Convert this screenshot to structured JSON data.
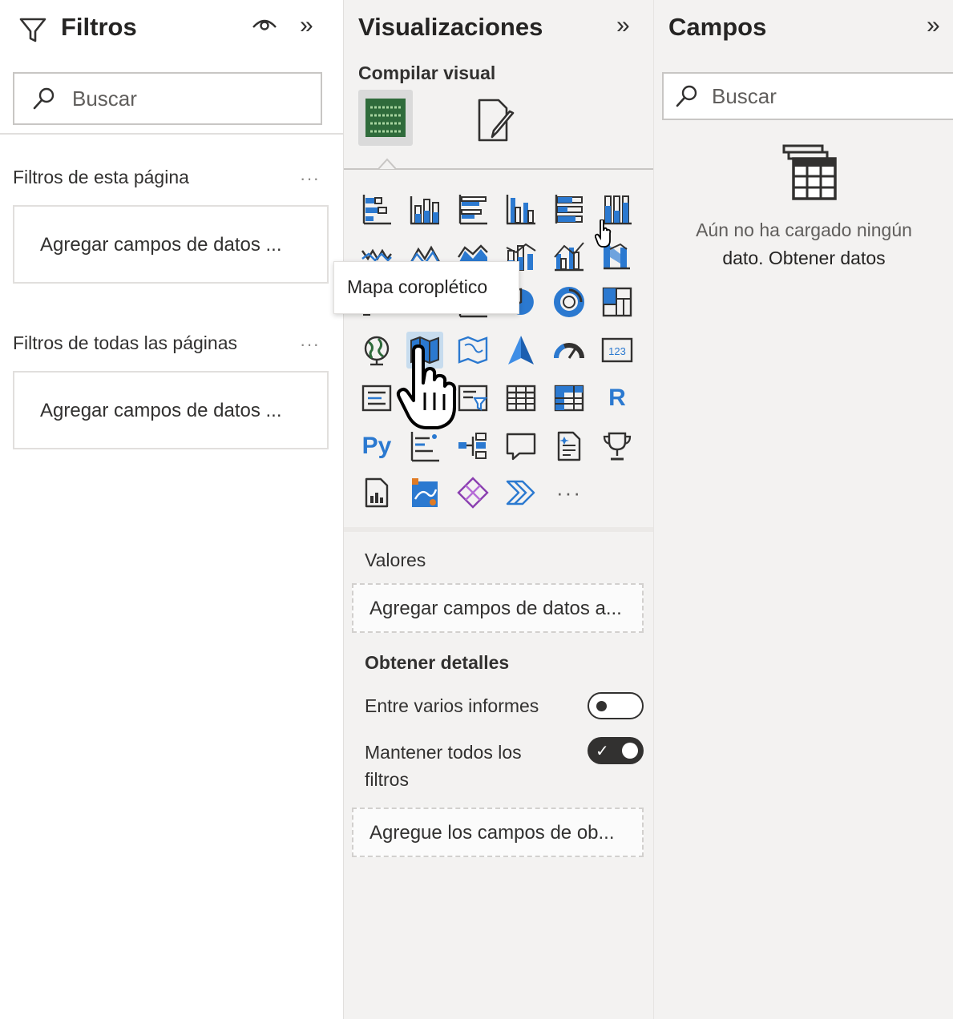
{
  "filters": {
    "title": "Filtros",
    "search_placeholder": "Buscar",
    "page_section": "Filtros de esta página",
    "page_dropzone": "Agregar campos de datos ...",
    "all_section": "Filtros de todas las páginas",
    "all_dropzone": "Agregar campos de datos ...",
    "more_label": "···",
    "collapse_label": "»"
  },
  "visualizations": {
    "title": "Visualizaciones",
    "collapse_label": "»",
    "build_label": "Compilar visual",
    "tooltip": "Mapa coroplético",
    "icons": [
      [
        "stacked-bar-chart-icon",
        "stacked-column-chart-icon",
        "clustered-bar-chart-icon",
        "clustered-column-chart-icon",
        "100-stacked-bar-chart-icon",
        "100-stacked-column-chart-icon"
      ],
      [
        "line-chart-icon",
        "area-chart-icon",
        "stacked-area-chart-icon",
        "line-stacked-column-icon",
        "line-clustered-column-icon",
        "ribbon-chart-icon"
      ],
      [
        "waterfall-chart-icon",
        "funnel-chart-icon",
        "scatter-chart-icon",
        "pie-chart-icon",
        "donut-chart-icon",
        "treemap-icon"
      ],
      [
        "map-icon",
        "filled-map-icon",
        "shape-map-icon",
        "azure-map-icon",
        "gauge-icon",
        "card-icon"
      ],
      [
        "multi-row-card-icon",
        "kpi-icon",
        "slicer-icon",
        "table-icon",
        "matrix-icon",
        "r-visual-icon"
      ],
      [
        "python-visual-icon",
        "key-influencers-icon",
        "decomposition-tree-icon",
        "qa-icon",
        "smart-narrative-icon",
        "metrics-icon"
      ],
      [
        "paginated-report-icon",
        "arcgis-map-icon",
        "power-apps-icon",
        "power-automate-icon",
        "more-visuals-icon"
      ]
    ],
    "r_label": "R",
    "py_label": "Py",
    "card_label": "123",
    "more_label": "···",
    "values_title": "Valores",
    "values_dropzone": "Agregar campos de datos a...",
    "drill_title": "Obtener detalles",
    "cross_report_label": "Entre varios informes",
    "cross_report_on": false,
    "keep_filters_label": "Mantener todos los filtros",
    "keep_filters_on": true,
    "drill_dropzone": "Agregue los campos de ob..."
  },
  "fields": {
    "title": "Campos",
    "collapse_label": "»",
    "search_placeholder": "Buscar",
    "empty_text": "Aún no ha cargado ningún",
    "empty_link": "dato. Obtener datos"
  },
  "colors": {
    "accent_blue": "#2b79d0",
    "icon_dark": "#323130",
    "hover_bg": "#c7dcee",
    "build_green": "#2f6b3b"
  }
}
